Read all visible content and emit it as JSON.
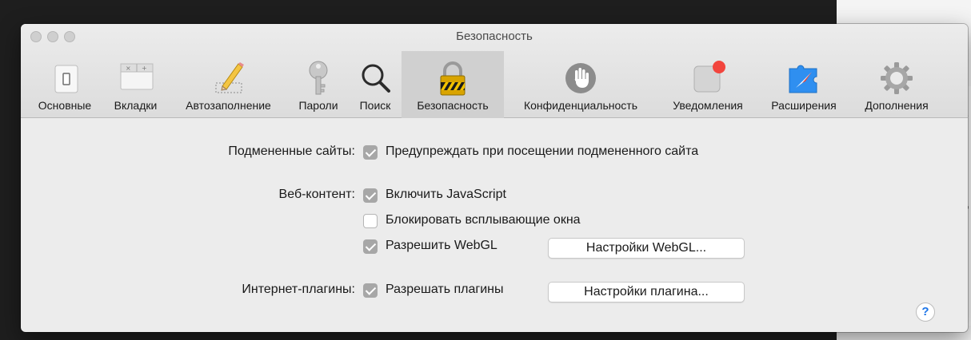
{
  "window": {
    "title": "Безопасность"
  },
  "toolbar": {
    "tabs": [
      {
        "label": "Основные",
        "icon": "general-switch-icon"
      },
      {
        "label": "Вкладки",
        "icon": "tabs-icon"
      },
      {
        "label": "Автозаполнение",
        "icon": "pencil-icon"
      },
      {
        "label": "Пароли",
        "icon": "key-icon"
      },
      {
        "label": "Поиск",
        "icon": "magnifier-icon"
      },
      {
        "label": "Безопасность",
        "icon": "lock-icon",
        "selected": true
      },
      {
        "label": "Конфиденциальность",
        "icon": "hand-icon"
      },
      {
        "label": "Уведомления",
        "icon": "notification-badge-icon"
      },
      {
        "label": "Расширения",
        "icon": "extensions-puzzle-icon"
      },
      {
        "label": "Дополнения",
        "icon": "gear-icon"
      }
    ]
  },
  "security": {
    "fraud_label": "Подмененные сайты:",
    "fraud_warn": {
      "label": "Предупреждать при посещении подмененного сайта",
      "checked": true
    },
    "web_content_label": "Веб-контент:",
    "javascript": {
      "label": "Включить JavaScript",
      "checked": true
    },
    "popups": {
      "label": "Блокировать всплывающие окна",
      "checked": false
    },
    "webgl": {
      "label": "Разрешить WebGL",
      "checked": true
    },
    "webgl_settings_button": "Настройки WebGL...",
    "plugins_label": "Интернет-плагины:",
    "plugins": {
      "label": "Разрешать плагины",
      "checked": true
    },
    "plugin_settings_button": "Настройки плагина...",
    "help_label": "?"
  },
  "colors": {
    "accent_help": "#1b74e8",
    "notification_dot": "#f2453d",
    "checkbox_checked": "#a7a7a7"
  }
}
